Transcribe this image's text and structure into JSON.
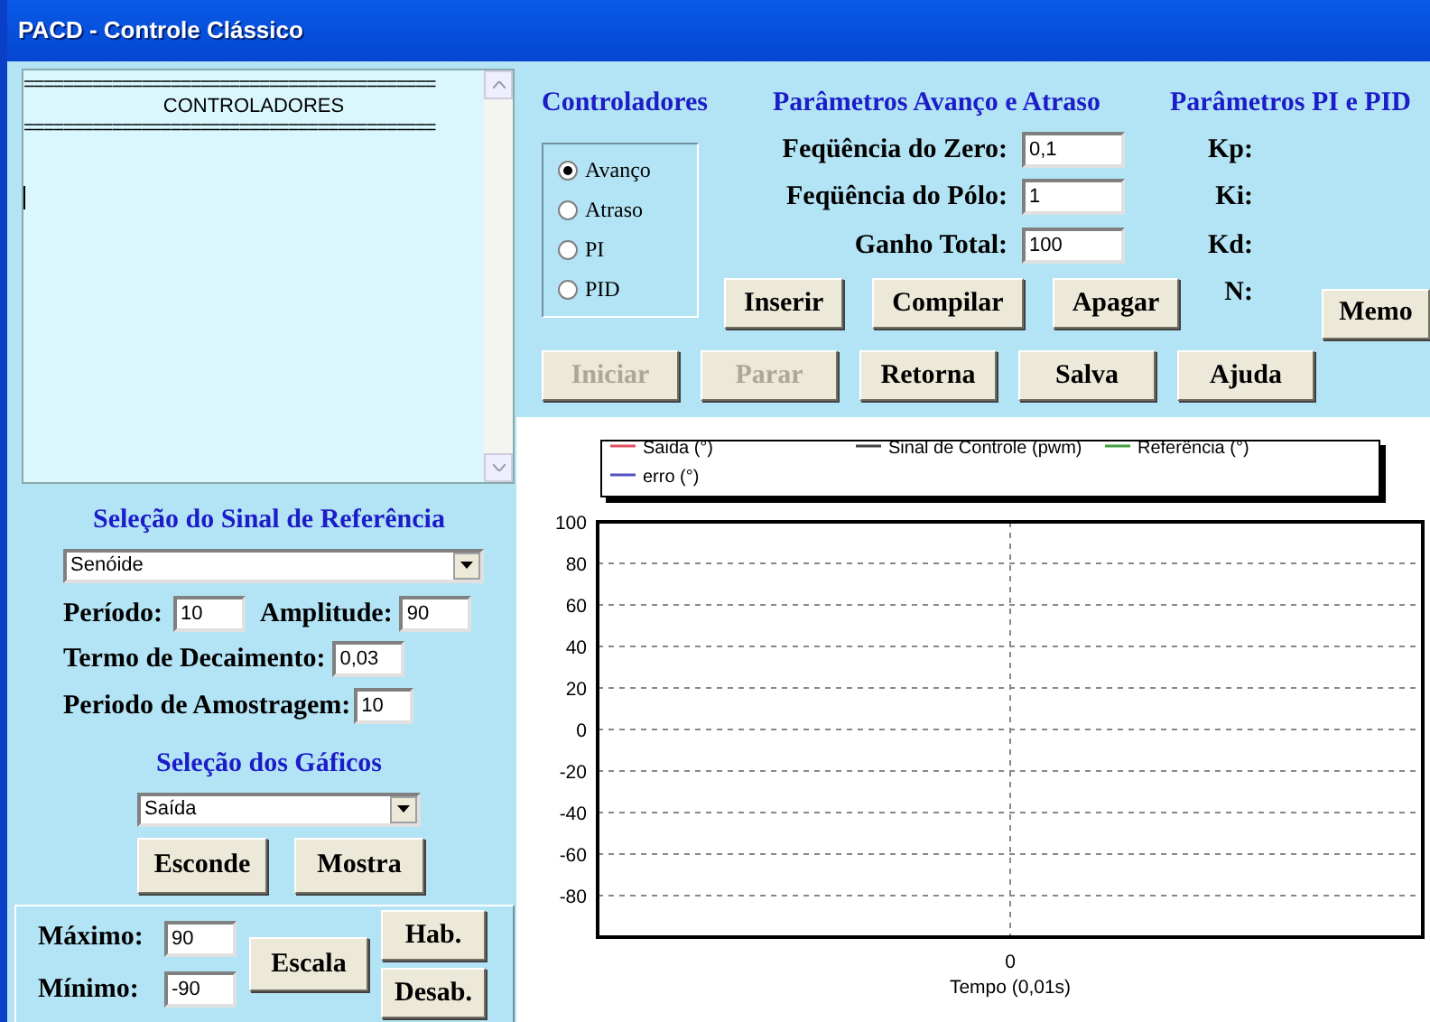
{
  "window": {
    "title": "PACD - Controle Clássico"
  },
  "memo": {
    "lines": [
      "==========================================",
      "CONTROLADORES",
      "=========================================="
    ]
  },
  "reference_signal": {
    "title": "Seleção do Sinal de Referência",
    "signal": "Senóide",
    "period_label": "Período:",
    "period": "10",
    "amplitude_label": "Amplitude:",
    "amplitude": "90",
    "decay_label": "Termo de Decaimento:",
    "decay": "0,03",
    "sampling_label": "Periodo de Amostragem:",
    "sampling": "10"
  },
  "graph_selection": {
    "title": "Seleção dos Gáficos",
    "graph": "Saída",
    "buttons": [
      {
        "label": "Esconde"
      },
      {
        "label": "Mostra"
      }
    ]
  },
  "scale": {
    "max_label": "Máximo:",
    "max": "90",
    "min_label": "Mínimo:",
    "min": "-90",
    "scale_button": "Escala",
    "enable_button": "Hab.",
    "disable_button": "Desab."
  },
  "controllers": {
    "title": "Controladores",
    "options": [
      {
        "label": "Avanço",
        "selected": true
      },
      {
        "label": "Atraso",
        "selected": false
      },
      {
        "label": "PI",
        "selected": false
      },
      {
        "label": "PID",
        "selected": false
      }
    ]
  },
  "lead_lag": {
    "title": "Parâmetros Avanço e Atraso",
    "fields": [
      {
        "label": "Feqüência do Zero:",
        "value": "0,1"
      },
      {
        "label": "Feqüência do Pólo:",
        "value": "1"
      },
      {
        "label": "Ganho Total:",
        "value": "100"
      }
    ],
    "buttons": [
      {
        "label": "Inserir"
      },
      {
        "label": "Compilar"
      },
      {
        "label": "Apagar"
      }
    ]
  },
  "pid": {
    "title": "Parâmetros PI e PID",
    "labels": [
      "Kp:",
      "Ki:",
      "Kd:",
      "N:"
    ],
    "memo_button": "Memo"
  },
  "actions": [
    {
      "label": "Iniciar",
      "disabled": true
    },
    {
      "label": "Parar",
      "disabled": true
    },
    {
      "label": "Retorna",
      "disabled": false
    },
    {
      "label": "Salva",
      "disabled": false
    },
    {
      "label": "Ajuda",
      "disabled": false
    }
  ],
  "chart": {
    "chart_data": {
      "type": "line",
      "xlabel": "Tempo (0,01s)",
      "categories": [
        "0"
      ],
      "grid": true,
      "ylim": [
        -100,
        100
      ],
      "yticks": [
        100,
        80,
        60,
        40,
        20,
        0,
        -20,
        -40,
        -60,
        -80
      ],
      "series": [
        {
          "name": "Saida (°)",
          "color": "#e05060",
          "values": [
            null
          ]
        },
        {
          "name": "erro (°)",
          "color": "#5050c0",
          "values": [
            null
          ]
        },
        {
          "name": "Sinal de Controle (pwm)",
          "color": "#404040",
          "values": [
            null
          ]
        },
        {
          "name": "Referência (°)",
          "color": "#40a040",
          "values": [
            null
          ]
        }
      ]
    }
  }
}
